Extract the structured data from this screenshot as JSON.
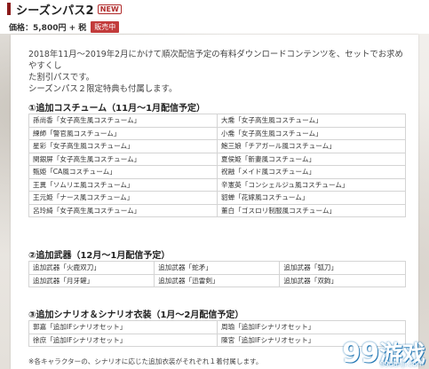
{
  "header": {
    "title": "シーズンパス2",
    "new_badge": "NEW",
    "price": "価格：5,800円 + 税",
    "sale_badge": "販売中"
  },
  "description": [
    "2018年11月～2019年2月にかけて順次配信予定の有料ダウンロードコンテンツを、セットでお求めやすくし",
    "た割引パスです。",
    "シーズンパス２限定特典も付属します。"
  ],
  "section1": {
    "title": "①追加コスチューム（11月～1月配信予定）",
    "rows": [
      [
        "孫尚香「女子高生風コスチューム」",
        "大喬「女子高生風コスチューム」"
      ],
      [
        "練師「警官風コスチューム」",
        "小喬「女子高生風コスチューム」"
      ],
      [
        "星彩「女子高生風コスチューム」",
        "鮑三娘「チアガール風コスチューム」"
      ],
      [
        "関銀屏「女子高生風コスチューム」",
        "夏侯姫「新妻風コスチューム」"
      ],
      [
        "甄姫「CA風コスチューム」",
        "祝融「メイド風コスチューム」"
      ],
      [
        "王異「ソムリエ風コスチューム」",
        "辛憲英「コンシェルジュ風コスチューム」"
      ],
      [
        "王元姫「ナース風コスチューム」",
        "貂蝉「花嫁風コスチューム」"
      ],
      [
        "呂玲綺「女子高生風コスチューム」",
        "董白「ゴスロリ制服風コスチューム」"
      ]
    ]
  },
  "section2": {
    "title": "②追加武器（12月～1月配信予定）",
    "rows": [
      [
        "追加武器「火鹿双刀」",
        "追加武器「蛇矛」",
        "追加武器「弧刀」"
      ],
      [
        "追加武器「月牙鏟」",
        "追加武器「迅雷剣」",
        "追加武器「双鉤」"
      ]
    ]
  },
  "section3": {
    "title": "③追加シナリオ＆シナリオ衣装（1月～2月配信予定）",
    "rows": [
      [
        "郭嘉「追加IFシナリオセット」",
        "周瑜「追加IFシナリオセット」"
      ],
      [
        "徐庶「追加IFシナリオセット」",
        "陳宮「追加IFシナリオセット」"
      ]
    ],
    "note": "※各キャラクターの、シナリオに応じた追加衣装がそれぞれ１着付属します。"
  },
  "watermark": {
    "logo_digits": "99",
    "logo_text": "游戏",
    "url": "99danji.com"
  }
}
